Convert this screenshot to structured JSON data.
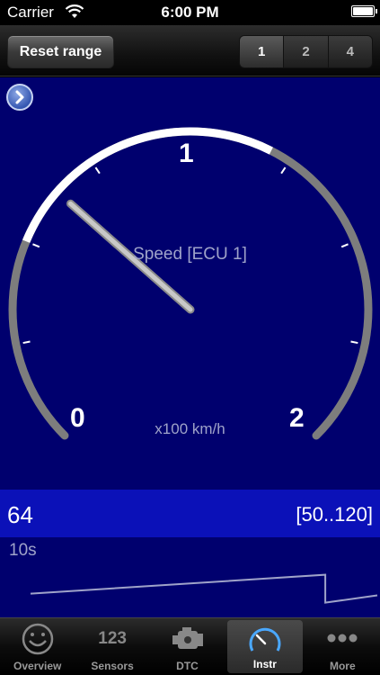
{
  "status_bar": {
    "carrier": "Carrier",
    "time": "6:00 PM"
  },
  "toolbar": {
    "reset_label": "Reset range",
    "segments": [
      "1",
      "2",
      "4"
    ],
    "selected_segment": "1"
  },
  "gauge": {
    "title": "Speed [ECU 1]",
    "unit": "x100  km/h",
    "scale_labels": [
      "0",
      "1",
      "2"
    ],
    "min": 0,
    "max": 2,
    "needle_value": 0.64,
    "highlight_range": [
      0.5,
      1.2
    ],
    "colors": {
      "background": "#00006e",
      "arc": "#7d7d7d",
      "arc_highlight": "#ffffff",
      "needle": "#c8c8c8"
    }
  },
  "readout": {
    "value": "64",
    "range": "[50..120]"
  },
  "history": {
    "span_label": "10s",
    "series": [
      {
        "t": 0.0,
        "v": 0.28
      },
      {
        "t": 0.85,
        "v": 0.62
      },
      {
        "t": 0.85,
        "v": 0.12
      },
      {
        "t": 1.0,
        "v": 0.25
      }
    ]
  },
  "tabbar": {
    "items": [
      {
        "label": "Overview",
        "icon": "smiley-icon"
      },
      {
        "label": "Sensors",
        "icon": "sensors-123-icon",
        "icon_text": "123"
      },
      {
        "label": "DTC",
        "icon": "engine-icon"
      },
      {
        "label": "Instr",
        "icon": "gauge-icon"
      },
      {
        "label": "More",
        "icon": "more-dots-icon"
      }
    ],
    "active": "Instr"
  }
}
